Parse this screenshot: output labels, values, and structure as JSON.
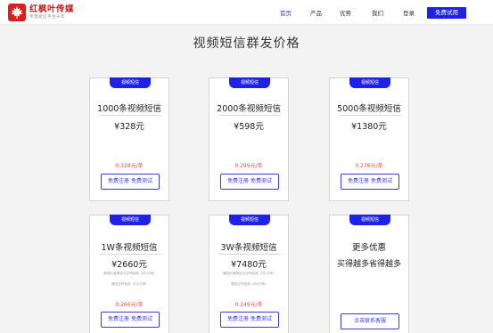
{
  "header": {
    "logo_name": "红枫叶传媒",
    "logo_slogan": "专营短信平台十年",
    "nav": [
      "首页",
      "产品",
      "优势",
      "我们",
      "登录"
    ],
    "cta": "免费试用",
    "accent": "#1f22e6",
    "brand": "#d9201f"
  },
  "page": {
    "title": "视频短信群发价格"
  },
  "cards": [
    {
      "badge": "视频短信",
      "title": "1000条视频短信",
      "price": "¥328元",
      "unit": "0.328元/条",
      "button": "免费注册 免费测试"
    },
    {
      "badge": "视频短信",
      "title": "2000条视频短信",
      "price": "¥598元",
      "unit": "0.299元/条",
      "button": "免费注册 免费测试"
    },
    {
      "badge": "视频短信",
      "title": "5000条视频短信",
      "price": "¥1380元",
      "unit": "0.276元/条",
      "button": "免费注册 免费测试"
    },
    {
      "badge": "视频短信",
      "title": "1W条视频短信",
      "price": "¥2660元",
      "note1": "赠送价值两百元空号检测（约1万条）",
      "note2": "赠送空号检测（约2万条）",
      "unit": "0.266元/条",
      "button": "免费注册 免费测试"
    },
    {
      "badge": "视频短信",
      "title": "3W条视频短信",
      "price": "¥7480元",
      "note1": "赠送价值两百元空号检测（约1万条）",
      "note2": "赠送空号检测（约2万条）",
      "unit": "0.249元/条",
      "button": "免费注册 免费测试"
    },
    {
      "badge": "视频短信",
      "title": "更多优惠",
      "subtitle": "买得越多省得越多",
      "button": "点击联系客服"
    }
  ]
}
